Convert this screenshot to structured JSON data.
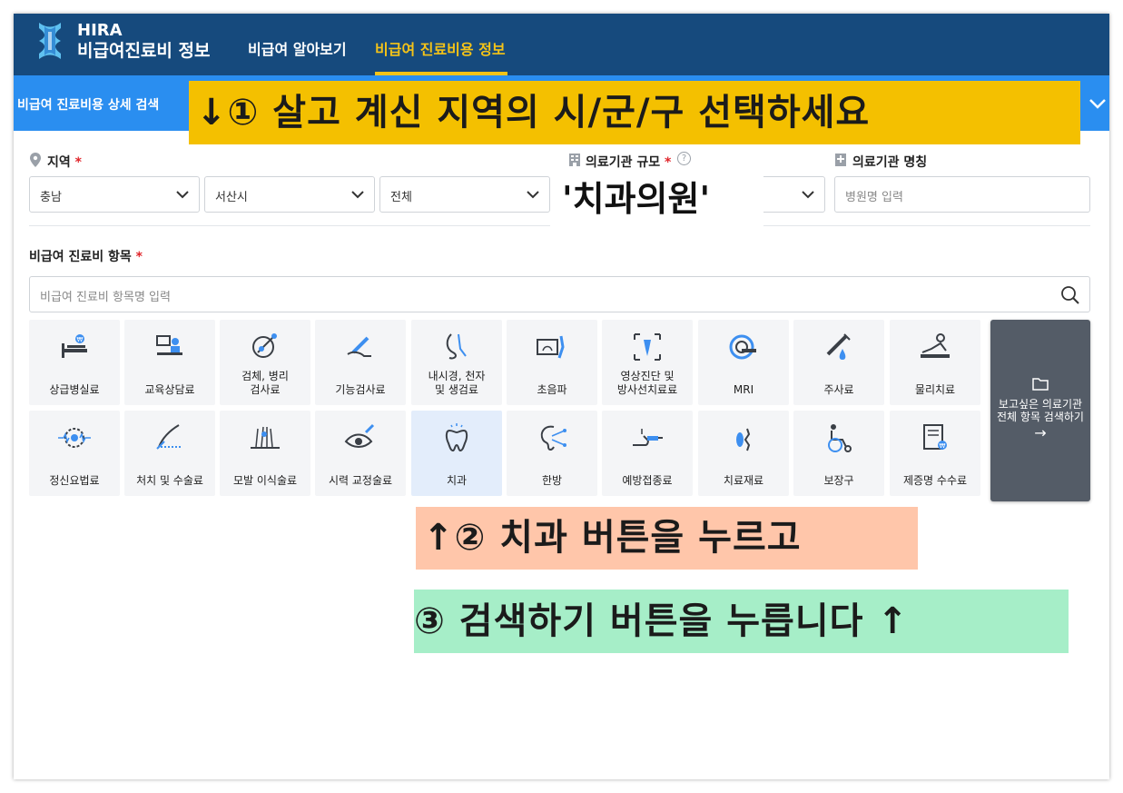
{
  "header": {
    "brand_line1": "HIRA",
    "brand_line2": "비급여진료비 정보",
    "nav": [
      "비급여 알아보기",
      "비급여 진료비용 정보"
    ],
    "active_nav": "비급여 진료비용 정보"
  },
  "search_bar": {
    "label": "비급여 진료비용 상세 검색"
  },
  "annotations": {
    "step1": "↓① 살고 계신 지역의 시/군/구 선택하세요",
    "scale_hint": "'치과의원'",
    "step2": "↑② 치과 버튼을 누르고",
    "step3": "③ 검색하기 버튼을 누릅니다 ↑"
  },
  "filters": {
    "region_label": "지역",
    "region_values": [
      "충남",
      "서산시",
      "전체"
    ],
    "scale_label": "의료기관 규모",
    "name_label": "의료기관 명칭",
    "name_placeholder": "병원명 입력",
    "required_mark": "*",
    "help_mark": "?"
  },
  "items": {
    "label": "비급여 진료비 항목",
    "search_placeholder": "비급여 진료비 항목명 입력",
    "row1": [
      {
        "icon": "hospital-bed-icon",
        "label": "상급병실료"
      },
      {
        "icon": "counseling-icon",
        "label": "교육상담료"
      },
      {
        "icon": "microscope-icon",
        "label": "검체, 병리\n검사료"
      },
      {
        "icon": "function-test-icon",
        "label": "기능검사료"
      },
      {
        "icon": "endoscope-icon",
        "label": "내시경, 천자\n및 생검료"
      },
      {
        "icon": "ultrasound-icon",
        "label": "초음파"
      },
      {
        "icon": "xray-icon",
        "label": "영상진단 및\n방사선치료료"
      },
      {
        "icon": "mri-icon",
        "label": "MRI"
      },
      {
        "icon": "syringe-icon",
        "label": "주사료"
      },
      {
        "icon": "physical-therapy-icon",
        "label": "물리치료"
      }
    ],
    "row2": [
      {
        "icon": "brainwave-icon",
        "label": "정신요법료"
      },
      {
        "icon": "surgery-icon",
        "label": "처치 및 수술료"
      },
      {
        "icon": "hair-transplant-icon",
        "label": "모발 이식술료"
      },
      {
        "icon": "eye-icon",
        "label": "시력 교정술료"
      },
      {
        "icon": "tooth-icon",
        "label": "치과"
      },
      {
        "icon": "ear-acupuncture-icon",
        "label": "한방"
      },
      {
        "icon": "vaccine-icon",
        "label": "예방접종료"
      },
      {
        "icon": "material-icon",
        "label": "치료재료"
      },
      {
        "icon": "wheelchair-icon",
        "label": "보장구"
      },
      {
        "icon": "certificate-icon",
        "label": "제증명 수수료"
      }
    ],
    "search_all": {
      "line1": "보고싶은 의료기관",
      "line2": "전체 항목 검색하기",
      "arrow": "→"
    }
  },
  "colors": {
    "nav_bg": "#164a7d",
    "accent": "#f4c318",
    "bar_blue": "#2a8ef0",
    "selected_tile": "#e3edfb"
  }
}
